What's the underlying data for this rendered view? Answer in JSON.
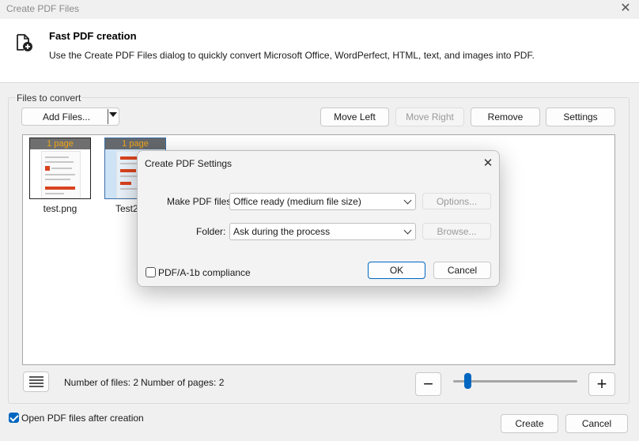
{
  "window": {
    "title": "Create PDF Files"
  },
  "header": {
    "title": "Fast PDF creation",
    "description": "Use the Create PDF Files dialog to quickly convert Microsoft Office, WordPerfect, HTML, text, and images into PDF."
  },
  "files_group": {
    "label": "Files to convert",
    "add_files_label": "Add Files...",
    "toolbar": {
      "move_left": "Move Left",
      "move_right": "Move Right",
      "remove": "Remove",
      "settings": "Settings"
    },
    "files": [
      {
        "name": "test.png",
        "badge": "1 page"
      },
      {
        "name": "Test2",
        "badge": "1 page"
      }
    ],
    "status": {
      "files": "Number of files: 2",
      "pages": "Number of pages: 2"
    },
    "zoom": {
      "minus": "−",
      "plus": "+",
      "level": 0.12
    }
  },
  "footer": {
    "open_after_label": "Open PDF files after creation",
    "open_after_checked": true,
    "create_label": "Create",
    "cancel_label": "Cancel"
  },
  "settings_dialog": {
    "title": "Create PDF Settings",
    "make_pdf_label": "Make PDF files:",
    "make_pdf_value": "Office ready (medium file size)",
    "options_label": "Options...",
    "folder_label": "Folder:",
    "folder_value": "Ask during the process",
    "browse_label": "Browse...",
    "pdfa_label": "PDF/A-1b compliance",
    "pdfa_checked": false,
    "ok_label": "OK",
    "cancel_label": "Cancel"
  },
  "colors": {
    "accent": "#0067c0",
    "badge_text": "#f2a516"
  }
}
